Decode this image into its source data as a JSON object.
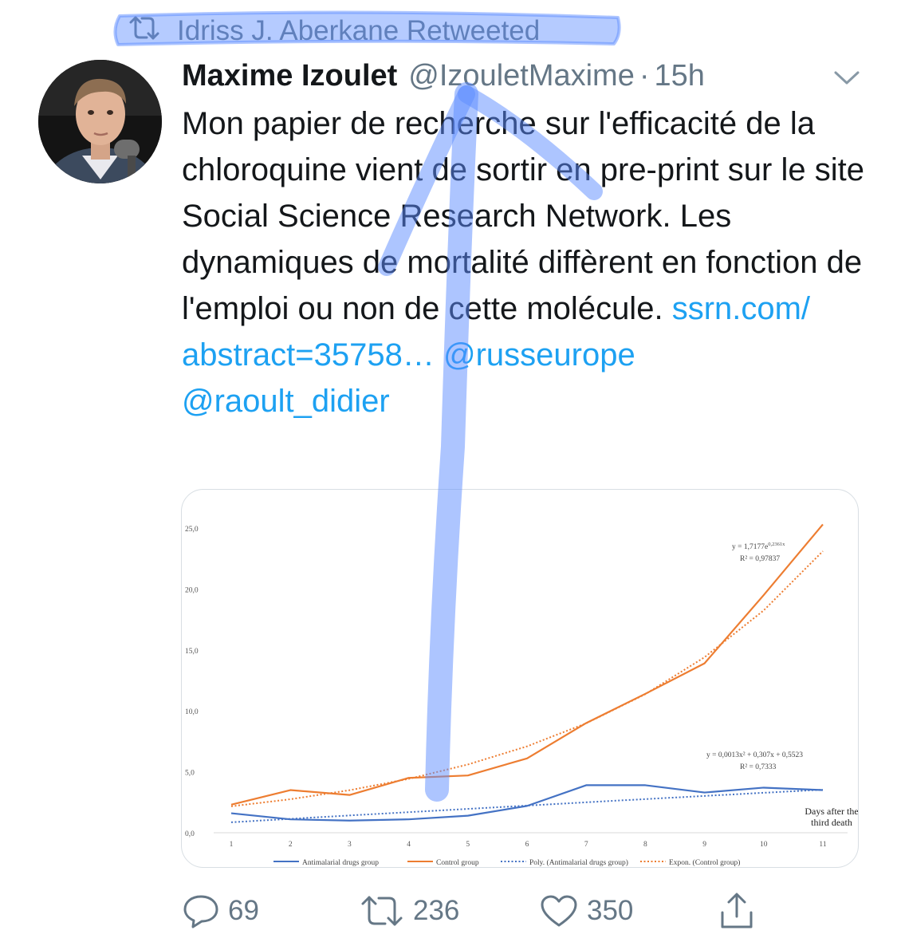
{
  "retweet_banner": {
    "text": "Idriss J. Aberkane Retweeted",
    "icon": "retweet-icon"
  },
  "author": {
    "name": "Maxime Izoulet",
    "handle": "@IzouletMaxime",
    "separator": "·",
    "time": "15h",
    "avatar_icon": "avatar"
  },
  "tweet": {
    "text": "Mon papier de recherche sur l'efficacité de la chloroquine vient de sortir en pre-print sur le site Social Science Research Network. Les dynamiques de mortalité diffèrent en fonction de l'emploi ou non de cette molécule.",
    "link1": "ssrn.com/",
    "link2": "abstract=35758…",
    "mention1": "@russeurope",
    "mention2": "@raoult_didier"
  },
  "actions": {
    "replies": "69",
    "retweets": "236",
    "likes": "350"
  },
  "colors": {
    "link": "#1da1f2",
    "muted": "#657786",
    "antimalarial": "#4472c4",
    "control": "#ed7d31",
    "scribble": "#5b8cff"
  },
  "chart_data": {
    "type": "line",
    "xlabel": "Days after the third death",
    "x": [
      1,
      2,
      3,
      4,
      5,
      6,
      7,
      8,
      9,
      10,
      11
    ],
    "ylim": [
      0,
      25
    ],
    "yticks": [
      "0,0",
      "5,0",
      "10,0",
      "15,0",
      "20,0",
      "25,0"
    ],
    "series": [
      {
        "name": "Antimalarial drugs group",
        "style": "solid",
        "color": "#4472c4",
        "values": [
          1.6,
          1.1,
          1.0,
          1.1,
          1.4,
          2.2,
          3.9,
          3.9,
          3.3,
          3.7,
          3.5
        ]
      },
      {
        "name": "Control group",
        "style": "solid",
        "color": "#ed7d31",
        "values": [
          2.3,
          3.5,
          3.1,
          4.5,
          4.7,
          6.1,
          9.0,
          11.4,
          13.9,
          19.5,
          25.3
        ]
      },
      {
        "name": "Poly. (Antimalarial drugs group)",
        "style": "dotted",
        "color": "#4472c4",
        "values": [
          0.86,
          1.14,
          1.42,
          1.69,
          1.96,
          2.23,
          2.5,
          2.76,
          3.02,
          3.28,
          3.53
        ]
      },
      {
        "name": "Expon. (Control group)",
        "style": "dotted",
        "color": "#ed7d31",
        "values": [
          2.17,
          2.75,
          3.49,
          4.42,
          5.6,
          7.09,
          8.98,
          11.37,
          14.4,
          18.24,
          23.1
        ]
      }
    ],
    "annotations": [
      {
        "text1": "y = 1,7177e",
        "sup": "0,2361x",
        "text2": "R² = 0,97837"
      },
      {
        "text1": "y = 0,0013x² + 0,307x + 0,5523",
        "text2": "R² = 0,7333"
      }
    ],
    "grid": false,
    "legend": "bottom"
  }
}
